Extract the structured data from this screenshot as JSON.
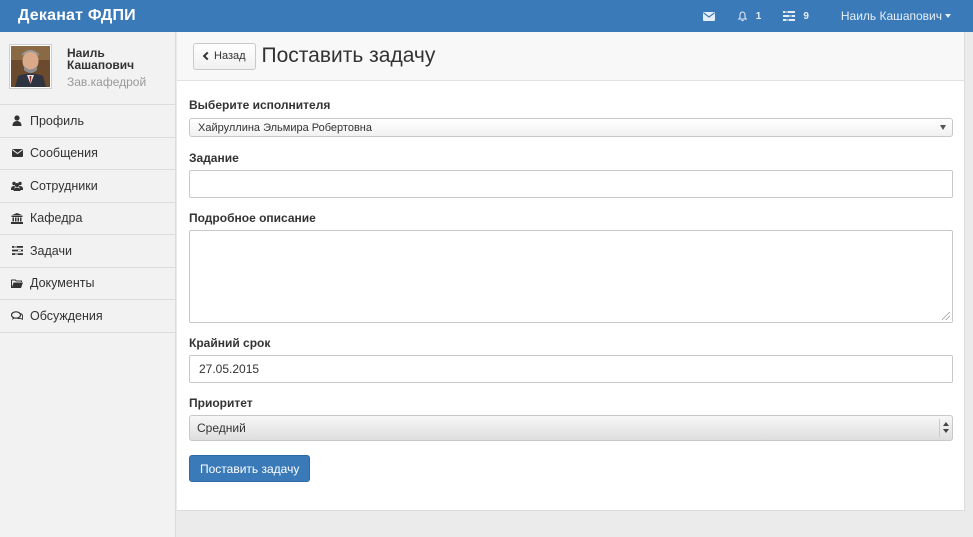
{
  "app": {
    "brand": "Деканат ФДПИ"
  },
  "navbar": {
    "messages_icon": "envelope-icon",
    "notifications": {
      "icon": "bell-icon",
      "count": "1"
    },
    "tasks": {
      "icon": "tasks-icon",
      "count": "9"
    },
    "user": {
      "name": "Наиль Кашапович"
    }
  },
  "profile": {
    "name": "Наиль Кашапович",
    "role": "Зав.кафедрой"
  },
  "sidebar": {
    "items": [
      {
        "label": "Профиль",
        "icon": "user-icon"
      },
      {
        "label": "Сообщения",
        "icon": "envelope-icon"
      },
      {
        "label": "Сотрудники",
        "icon": "users-icon"
      },
      {
        "label": "Кафедра",
        "icon": "institution-icon"
      },
      {
        "label": "Задачи",
        "icon": "tasks-icon"
      },
      {
        "label": "Документы",
        "icon": "folder-icon"
      },
      {
        "label": "Обсуждения",
        "icon": "comments-icon"
      }
    ]
  },
  "header": {
    "back_label": "Назад",
    "title": "Поставить задачу"
  },
  "form": {
    "executor": {
      "label": "Выберите исполнителя",
      "value": "Хайруллина Эльмира Робертовна"
    },
    "task": {
      "label": "Задание",
      "value": ""
    },
    "description": {
      "label": "Подробное описание",
      "value": ""
    },
    "deadline": {
      "label": "Крайний срок",
      "value": "27.05.2015"
    },
    "priority": {
      "label": "Приоритет",
      "value": "Средний"
    },
    "submit_label": "Поставить задачу"
  }
}
